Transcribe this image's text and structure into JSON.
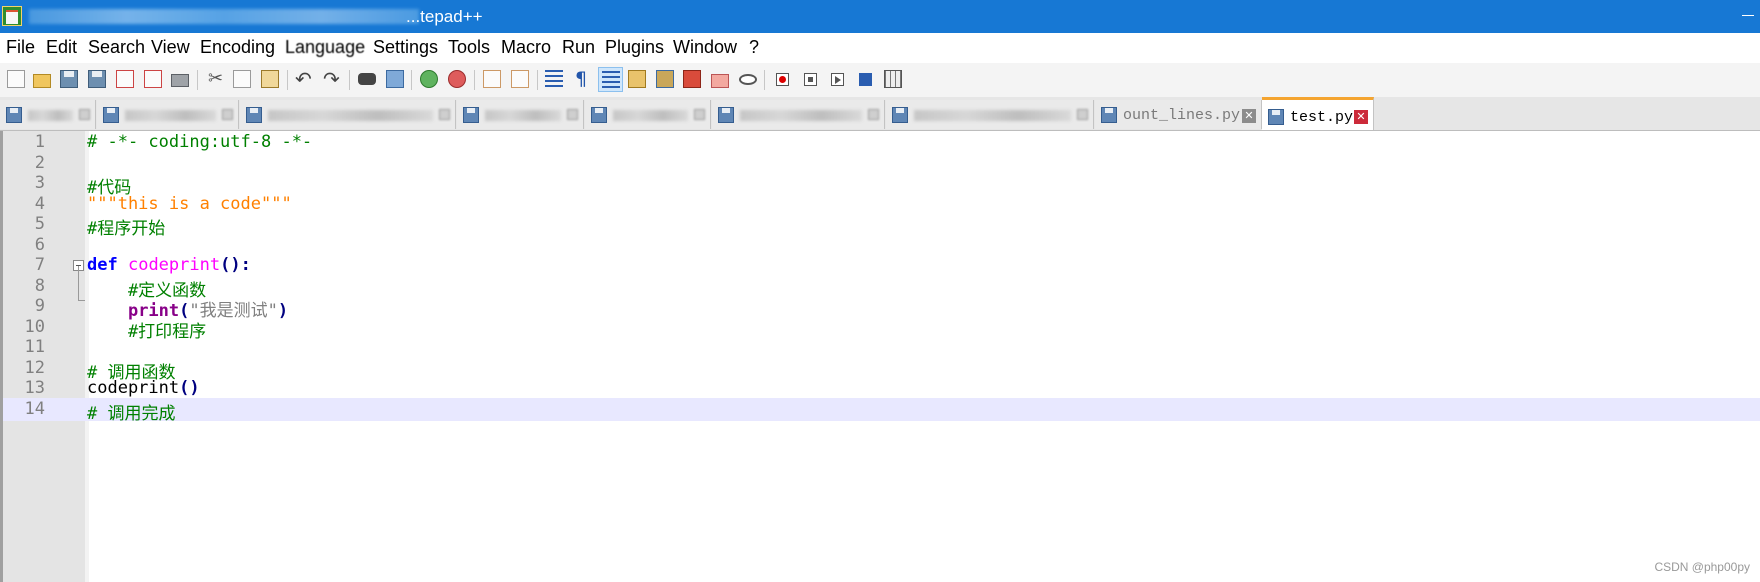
{
  "window": {
    "title": "...tepad++"
  },
  "menu": [
    "File",
    "Edit",
    "Search",
    "View",
    "Encoding",
    "Language",
    "Settings",
    "Tools",
    "Macro",
    "Run",
    "Plugins",
    "Window",
    "?"
  ],
  "toolbar_icons": [
    "new-file-icon",
    "open-file-icon",
    "save-icon",
    "save-all-icon",
    "close-icon",
    "close-all-icon",
    "print-icon",
    "cut-icon",
    "copy-icon",
    "paste-icon",
    "undo-icon",
    "redo-icon",
    "find-icon",
    "replace-icon",
    "zoom-in-icon",
    "zoom-out-icon",
    "sync-vertical-icon",
    "sync-horizontal-icon",
    "word-wrap-icon",
    "show-all-chars-icon",
    "indent-guide-icon",
    "udl-icon",
    "doc-map-icon",
    "function-list-icon",
    "folder-workspace-icon",
    "monitoring-icon",
    "record-macro-icon",
    "stop-macro-icon",
    "play-macro-icon",
    "run-macro-multiple-icon",
    "save-macro-icon"
  ],
  "tabs": [
    {
      "label": "",
      "blurred": true
    },
    {
      "label": "",
      "blurred": true
    },
    {
      "label": "",
      "blurred": true
    },
    {
      "label": "",
      "blurred": true
    },
    {
      "label": "",
      "blurred": true
    },
    {
      "label": "",
      "blurred": true
    },
    {
      "label": "",
      "blurred": true
    },
    {
      "label": "ount_lines.py",
      "blurred": false
    },
    {
      "label": "test.py",
      "active": true
    }
  ],
  "editor": {
    "current_line": 14,
    "lines": [
      {
        "num": "1",
        "text": "# -*- coding:utf-8 -*-"
      },
      {
        "num": "2",
        "text": ""
      },
      {
        "num": "3",
        "text": "#代码"
      },
      {
        "num": "4",
        "text": "\"\"\"this is a code\"\"\""
      },
      {
        "num": "5",
        "text": "#程序开始"
      },
      {
        "num": "6",
        "text": ""
      },
      {
        "num": "7",
        "kw": "def",
        "fn": "codeprint",
        "op": "():"
      },
      {
        "num": "8",
        "text": "    #定义函数"
      },
      {
        "num": "9",
        "indent": "    ",
        "bi": "print",
        "op1": "(",
        "str": "\"我是测试\"",
        "op2": ")"
      },
      {
        "num": "10",
        "text": "    #打印程序"
      },
      {
        "num": "11",
        "text": ""
      },
      {
        "num": "12",
        "text": "# 调用函数"
      },
      {
        "num": "13",
        "name": "codeprint",
        "op": "()"
      },
      {
        "num": "14",
        "text": "# 调用完成"
      }
    ]
  },
  "watermark": "CSDN @php00py",
  "colors": {
    "titlebar": "#1778d4",
    "comment": "#008000",
    "keyword": "#0000ff",
    "function": "#ff00ff",
    "docstring": "#ff8000",
    "active_tab_accent": "#f4a430",
    "current_line_bg": "#e8e8ff"
  }
}
